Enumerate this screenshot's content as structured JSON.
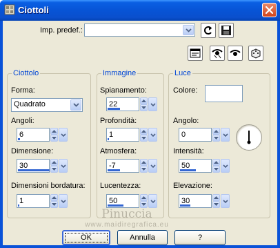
{
  "window": {
    "title": "Ciottoli"
  },
  "preset": {
    "label": "Imp. predef.:",
    "value": ""
  },
  "groups": {
    "ciottolo": {
      "title": "Ciottolo",
      "forma_label": "Forma:",
      "forma_value": "Quadrato",
      "angoli_label": "Angoli:",
      "angoli_value": "6",
      "dimensione_label": "Dimensione:",
      "dimensione_value": "30",
      "bordatura_label": "Dimensioni bordatura:",
      "bordatura_value": "1"
    },
    "immagine": {
      "title": "Immagine",
      "spianamento_label": "Spianamento:",
      "spianamento_value": "22",
      "profondita_label": "Profondità:",
      "profondita_value": "1",
      "atmosfera_label": "Atmosfera:",
      "atmosfera_value": "-7",
      "lucentezza_label": "Lucentezza:",
      "lucentezza_value": "50"
    },
    "luce": {
      "title": "Luce",
      "colore_label": "Colore:",
      "colore_value": "#ffffff",
      "angolo_label": "Angolo:",
      "angolo_value": "0",
      "intensita_label": "Intensità:",
      "intensita_value": "50",
      "elevazione_label": "Elevazione:",
      "elevazione_value": "30"
    }
  },
  "slider_levels": {
    "angoli": 0.06,
    "dimensione": 1.0,
    "bordatura": 0.02,
    "spianamento": 0.4,
    "profondita": 0.02,
    "atmosfera": 0.4,
    "lucentezza": 0.5,
    "intensita": 0.5,
    "elevazione": 0.33
  },
  "buttons": {
    "ok": "OK",
    "cancel": "Annulla",
    "help": "?"
  },
  "watermark": {
    "line1": "Pinuccia",
    "line2": "www.maidiregrafica.eu"
  },
  "icons": {
    "title": "ciottoli-app-icon",
    "reset_preset": "reset-arrow-icon",
    "save_preset": "floppy-save-icon",
    "proof": "preview-window-icon",
    "eye_toggle": "eye-toggle-icon",
    "eye": "eye-icon",
    "random": "dice-icon"
  },
  "colors": {
    "accent": "#0046d5",
    "titlebar": "#0754d6",
    "face": "#ece9d8",
    "slider_fill": "#3265d2"
  }
}
